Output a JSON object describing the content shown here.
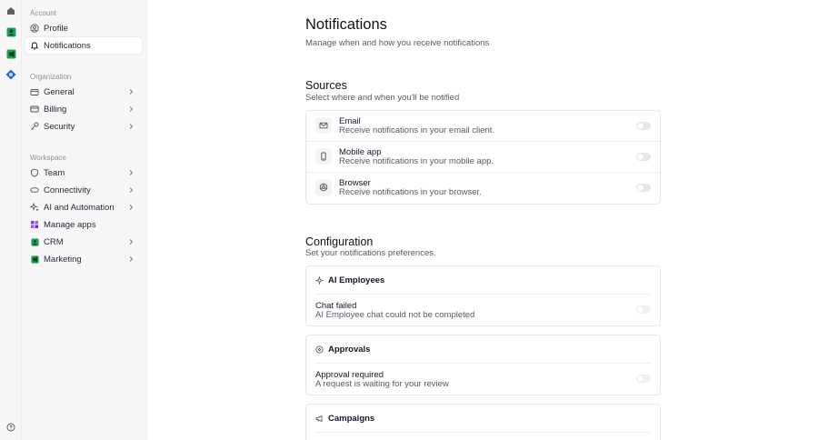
{
  "rail": {
    "icons": [
      "home-icon",
      "crm-icon",
      "marketing-icon",
      "app-icon"
    ],
    "help_icon": "help-icon",
    "colors": {
      "crm": "#1aa05a",
      "marketing": "#18a34a",
      "app": "#2563eb"
    }
  },
  "sidebar": {
    "account_label": "Account",
    "account_items": [
      {
        "label": "Profile",
        "icon": "user-circle-icon",
        "chevron": false,
        "active": false
      },
      {
        "label": "Notifications",
        "icon": "bell-icon",
        "chevron": false,
        "active": true
      }
    ],
    "organization_label": "Organization",
    "organization_items": [
      {
        "label": "General",
        "icon": "building-icon",
        "chevron": true
      },
      {
        "label": "Billing",
        "icon": "credit-card-icon",
        "chevron": true
      },
      {
        "label": "Security",
        "icon": "key-icon",
        "chevron": true
      }
    ],
    "workspace_label": "Workspace",
    "workspace_items": [
      {
        "label": "Team",
        "icon": "shield-icon",
        "chevron": true
      },
      {
        "label": "Connectivity",
        "icon": "link-icon",
        "chevron": true
      },
      {
        "label": "AI and Automation",
        "icon": "sparkle-icon",
        "chevron": true
      },
      {
        "label": "Manage apps",
        "icon": "apps-grid-icon",
        "chevron": false
      },
      {
        "label": "CRM",
        "icon": "crm-icon",
        "chevron": true
      },
      {
        "label": "Marketing",
        "icon": "marketing-icon",
        "chevron": true
      }
    ]
  },
  "main": {
    "title": "Notifications",
    "subtitle": "Manage when and how you receive notifications",
    "sources": {
      "title": "Sources",
      "subtitle": "Select where and when you'll be notified",
      "items": [
        {
          "title": "Email",
          "desc": "Receive notifications in your email client.",
          "icon": "mail-icon",
          "enabled": false
        },
        {
          "title": "Mobile app",
          "desc": "Receive notifications in your mobile app.",
          "icon": "mobile-icon",
          "enabled": false
        },
        {
          "title": "Browser",
          "desc": "Receive notifications in your browser.",
          "icon": "browser-icon",
          "enabled": false
        }
      ]
    },
    "configuration": {
      "title": "Configuration",
      "subtitle": "Set your notifications preferences.",
      "groups": [
        {
          "title": "AI Employees",
          "icon": "sparkle-icon",
          "row_title": "Chat failed",
          "row_desc": "AI Employee chat could not be completed",
          "enabled": false
        },
        {
          "title": "Approvals",
          "icon": "approval-icon",
          "row_title": "Approval required",
          "row_desc": "A request is waiting for your review",
          "enabled": false
        },
        {
          "title": "Campaigns",
          "icon": "megaphone-icon"
        }
      ]
    }
  }
}
